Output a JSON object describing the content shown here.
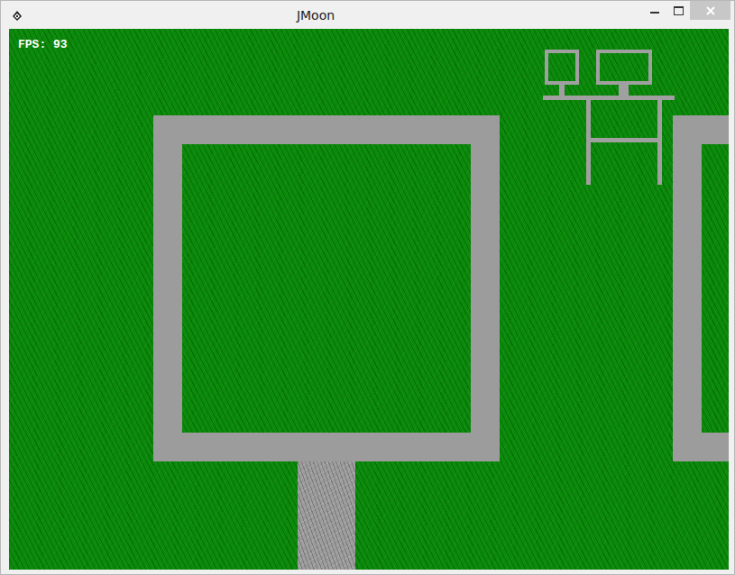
{
  "window": {
    "title": "JMoon"
  },
  "hud": {
    "fps": "FPS: 93"
  }
}
